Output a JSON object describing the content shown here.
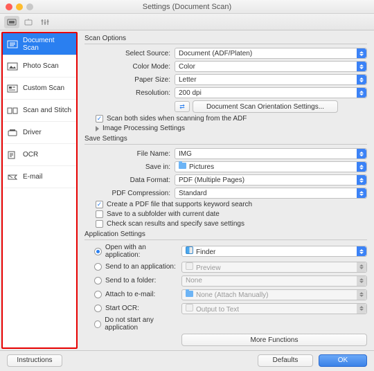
{
  "window": {
    "title": "Settings (Document Scan)"
  },
  "sidebar": {
    "items": [
      {
        "label": "Document Scan"
      },
      {
        "label": "Photo Scan"
      },
      {
        "label": "Custom Scan"
      },
      {
        "label": "Scan and Stitch"
      },
      {
        "label": "Driver"
      },
      {
        "label": "OCR"
      },
      {
        "label": "E-mail"
      }
    ]
  },
  "sections": {
    "scan_options": "Scan Options",
    "save_settings": "Save Settings",
    "app_settings": "Application Settings"
  },
  "scan": {
    "select_source_label": "Select Source:",
    "select_source_value": "Document (ADF/Platen)",
    "color_mode_label": "Color Mode:",
    "color_mode_value": "Color",
    "paper_size_label": "Paper Size:",
    "paper_size_value": "Letter",
    "resolution_label": "Resolution:",
    "resolution_value": "200 dpi",
    "orientation_btn": "Document Scan Orientation Settings...",
    "scan_both_sides": "Scan both sides when scanning from the ADF",
    "image_processing": "Image Processing Settings"
  },
  "save": {
    "file_name_label": "File Name:",
    "file_name_value": "IMG",
    "save_in_label": "Save in:",
    "save_in_value": "Pictures",
    "data_format_label": "Data Format:",
    "data_format_value": "PDF (Multiple Pages)",
    "pdf_compression_label": "PDF Compression:",
    "pdf_compression_value": "Standard",
    "create_pdf": "Create a PDF file that supports keyword search",
    "save_subfolder": "Save to a subfolder with current date",
    "check_results": "Check scan results and specify save settings"
  },
  "app": {
    "open_with": "Open with an application:",
    "open_with_value": "Finder",
    "send_to_app": "Send to an application:",
    "send_to_app_value": "Preview",
    "send_to_folder": "Send to a folder:",
    "send_to_folder_value": "None",
    "attach_email": "Attach to e-mail:",
    "attach_email_value": "None (Attach Manually)",
    "start_ocr": "Start OCR:",
    "start_ocr_value": "Output to Text",
    "do_not_start": "Do not start any application",
    "more_functions": "More Functions"
  },
  "footer": {
    "instructions": "Instructions",
    "defaults": "Defaults",
    "ok": "OK"
  }
}
